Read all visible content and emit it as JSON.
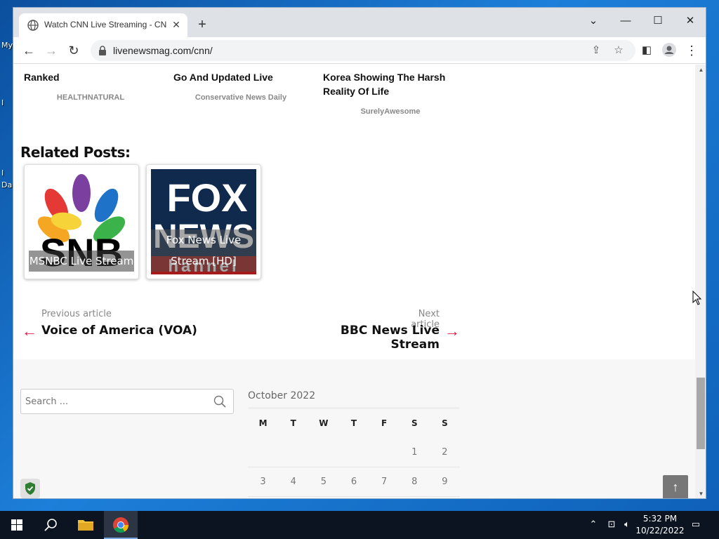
{
  "desktop": {
    "labels": [
      "My",
      "I",
      "I",
      "Da"
    ]
  },
  "browser": {
    "tab_title": "Watch CNN Live Streaming - CNN",
    "url": "livenewsmag.com/cnn/",
    "new_tab_symbol": "+"
  },
  "articles": [
    {
      "title": "Ranked",
      "source": "HEALTHNATURAL"
    },
    {
      "title": "Go And Updated Live",
      "source": "Conservative News Daily"
    },
    {
      "title": "Korea Showing The Harsh Reality Of Life",
      "source": "SurelyAwesome"
    }
  ],
  "related": {
    "heading": "Related Posts:",
    "posts": [
      {
        "label": "MSNBC Live Stream",
        "logo_text": "SNB"
      },
      {
        "label": "Fox News Live Stream [HD]",
        "logo_text_1": "FOX",
        "logo_text_2": "NEWS",
        "logo_text_3": "hannel"
      }
    ]
  },
  "nav": {
    "prev_label": "Previous article",
    "prev_title": "Voice of America (VOA)",
    "next_label": "Next article",
    "next_title": "BBC News Live Stream"
  },
  "footer": {
    "search_placeholder": "Search ...",
    "calendar": {
      "caption": "October 2022",
      "weekdays": [
        "M",
        "T",
        "W",
        "T",
        "F",
        "S",
        "S"
      ],
      "weeks": [
        [
          "",
          "",
          "",
          "",
          "",
          "1",
          "2"
        ],
        [
          "3",
          "4",
          "5",
          "6",
          "7",
          "8",
          "9"
        ]
      ]
    }
  },
  "taskbar": {
    "time": "5:32 PM",
    "date": "10/22/2022"
  },
  "colors": {
    "accent_arrow": "#e0143c",
    "taskbar": "#0b1420",
    "tabstrip": "#dee1e6"
  }
}
